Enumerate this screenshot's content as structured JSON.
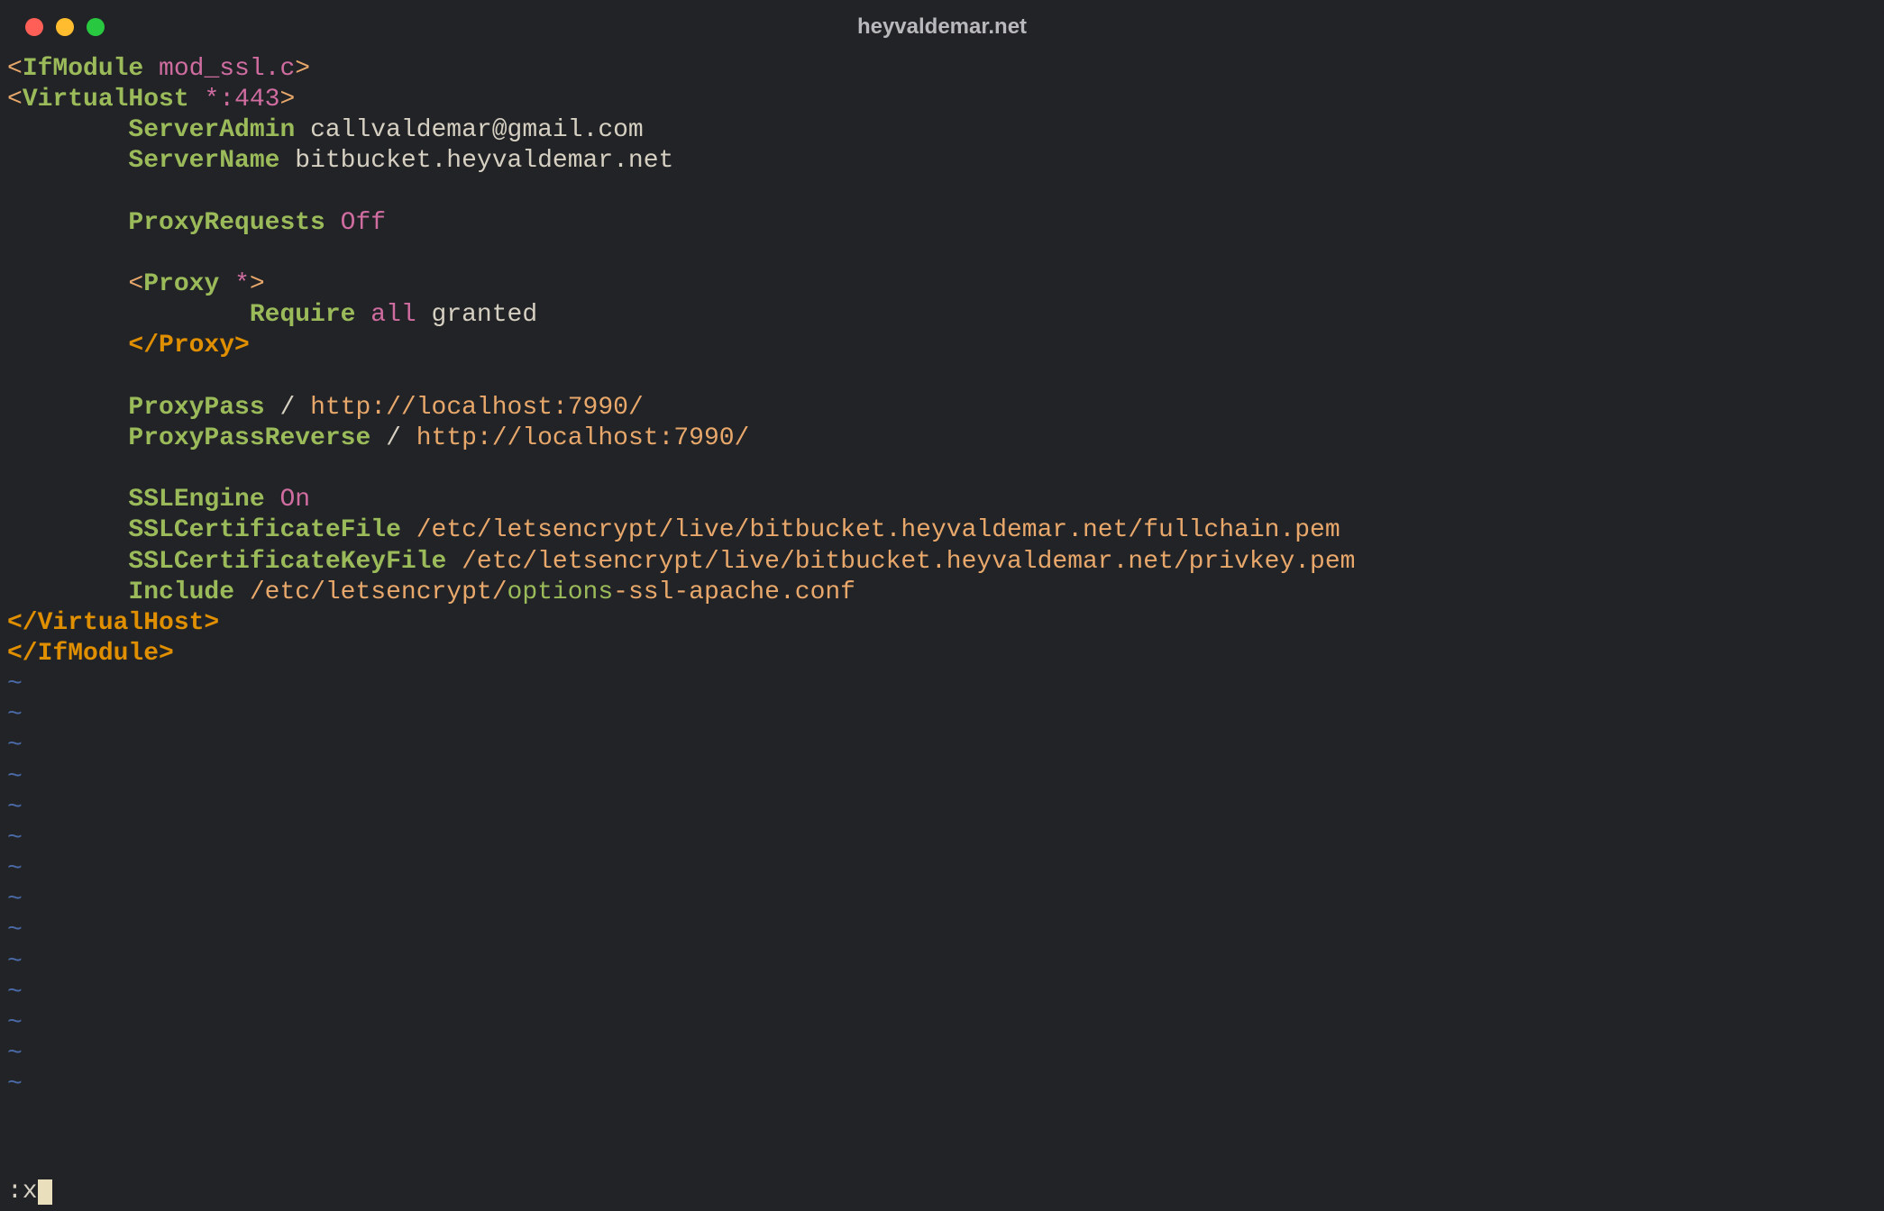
{
  "window": {
    "title": "heyvaldemar.net"
  },
  "config": {
    "l1": {
      "open": "<",
      "tag": "IfModule",
      "arg": "mod_ssl.c",
      "close": ">"
    },
    "l2": {
      "open": "<",
      "tag": "VirtualHost",
      "arg": "*:443",
      "close": ">"
    },
    "server_admin": {
      "key": "ServerAdmin",
      "val": "callvaldemar@gmail.com"
    },
    "server_name": {
      "key": "ServerName",
      "val": "bitbucket.heyvaldemar.net"
    },
    "proxy_requests": {
      "key": "ProxyRequests",
      "val": "Off"
    },
    "proxy_open": {
      "open": "<",
      "tag": "Proxy",
      "arg": "*",
      "close": ">"
    },
    "require": {
      "key": "Require",
      "arg": "all",
      "val": "granted"
    },
    "proxy_close": "</Proxy>",
    "proxy_pass": {
      "key": "ProxyPass",
      "slash": "/",
      "url": "http://localhost:7990/"
    },
    "proxy_pass_reverse": {
      "key": "ProxyPassReverse",
      "slash": "/",
      "url": "http://localhost:7990/"
    },
    "ssl_engine": {
      "key": "SSLEngine",
      "val": "On"
    },
    "ssl_cert_file": {
      "key": "SSLCertificateFile",
      "val": "/etc/letsencrypt/live/bitbucket.heyvaldemar.net/fullchain.pem"
    },
    "ssl_cert_key_file": {
      "key": "SSLCertificateKeyFile",
      "val": "/etc/letsencrypt/live/bitbucket.heyvaldemar.net/privkey.pem"
    },
    "include": {
      "key": "Include",
      "a": "/etc/letsencrypt/",
      "b": "options",
      "c": "-ssl-apache.conf"
    },
    "vh_close": "</VirtualHost>",
    "ifm_close": "</IfModule>"
  },
  "tilde_count": 14,
  "statusline": {
    "cmd": ":x"
  }
}
